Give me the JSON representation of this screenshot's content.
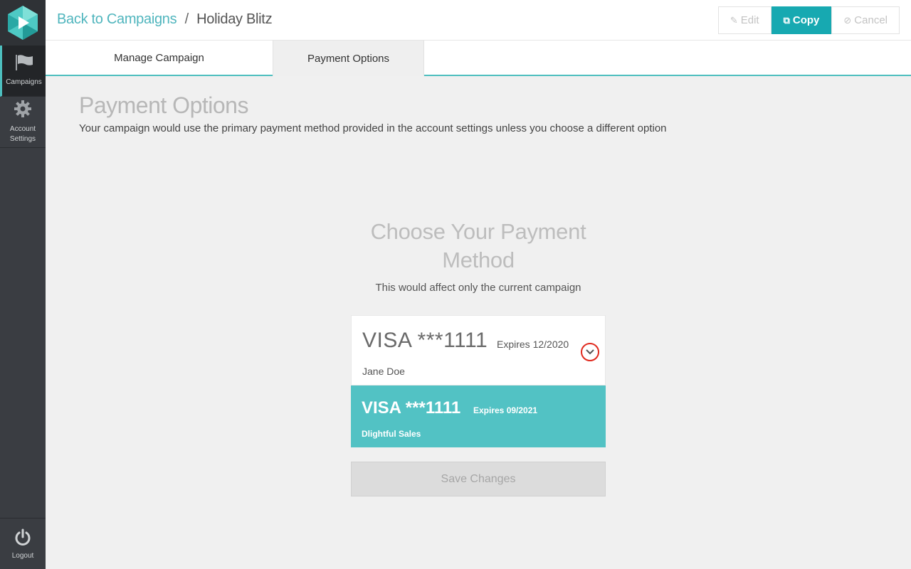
{
  "sidebar": {
    "items": [
      {
        "label": "Campaigns",
        "icon": "flag-icon"
      },
      {
        "label": "Account Settings",
        "icon": "gear-icon"
      }
    ],
    "logout_label": "Logout"
  },
  "header": {
    "breadcrumb_link": "Back to Campaigns",
    "breadcrumb_separator": "/",
    "breadcrumb_current": "Holiday Blitz",
    "edit_label": "Edit",
    "copy_label": "Copy",
    "cancel_label": "Cancel"
  },
  "tabs": [
    {
      "label": "Manage Campaign"
    },
    {
      "label": "Payment Options"
    }
  ],
  "main": {
    "title": "Payment Options",
    "description": "Your campaign would use the primary payment method provided in the account settings unless you choose a different option",
    "choose_title": "Choose Your Payment Method",
    "choose_subtitle": "This would affect only the current campaign",
    "selected_card": {
      "number": "VISA ***1111",
      "expires": "Expires 12/2020",
      "name": "Jane Doe"
    },
    "option_card": {
      "number": "VISA ***1111",
      "expires": "Expires 09/2021",
      "name": "Dlightful Sales"
    },
    "save_label": "Save Changes"
  },
  "colors": {
    "accent": "#17a9b1",
    "option_bg": "#52c2c4",
    "sidebar": "#3a3d42",
    "highlight_circle": "#e02a1e"
  }
}
